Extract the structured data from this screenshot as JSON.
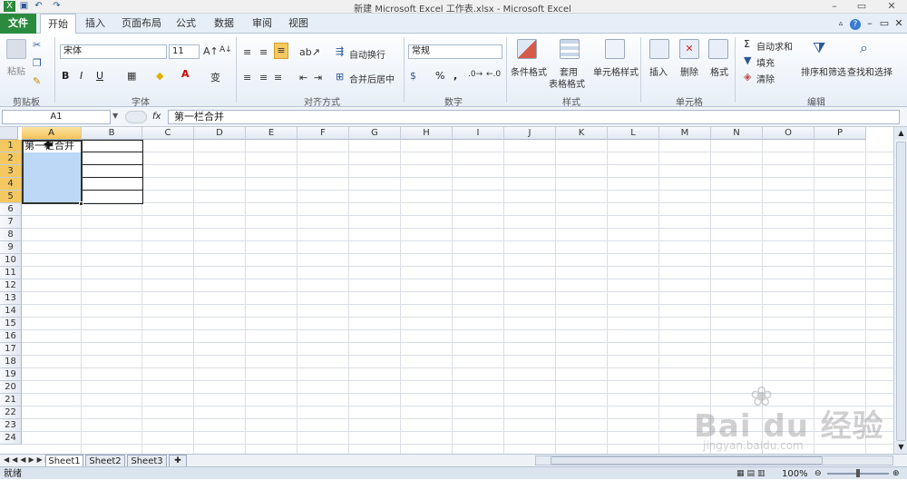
{
  "window": {
    "title": "新建 Microsoft Excel 工作表.xlsx - Microsoft Excel"
  },
  "tabs": [
    "文件",
    "开始",
    "插入",
    "页面布局",
    "公式",
    "数据",
    "审阅",
    "视图"
  ],
  "ribbon": {
    "clipboard": {
      "paste": "粘贴",
      "group": "剪贴板"
    },
    "font": {
      "name": "宋体",
      "size": "11",
      "bold": "B",
      "italic": "I",
      "underline": "U",
      "group": "字体"
    },
    "alignment": {
      "wrap": "自动换行",
      "merge": "合并后居中",
      "group": "对齐方式"
    },
    "number": {
      "format": "常规",
      "percent": "%",
      "comma": ",",
      "group": "数字"
    },
    "styles": {
      "conditional": "条件格式",
      "table_line1": "套用",
      "table_line2": "表格格式",
      "cell_styles": "单元格样式",
      "group": "样式"
    },
    "cells": {
      "insert": "插入",
      "delete": "删除",
      "format": "格式",
      "group": "单元格"
    },
    "editing": {
      "autosum": "自动求和",
      "fill": "填充",
      "clear": "清除",
      "sort": "排序和筛选",
      "find": "查找和选择",
      "group": "编辑"
    }
  },
  "formula_bar": {
    "name_box": "A1",
    "fx": "fx",
    "value": "第一栏合并"
  },
  "columns": [
    "A",
    "B",
    "C",
    "D",
    "E",
    "F",
    "G",
    "H",
    "I",
    "J",
    "K",
    "L",
    "M",
    "N",
    "O",
    "P"
  ],
  "rows": [
    "1",
    "2",
    "3",
    "4",
    "5",
    "6",
    "7",
    "8",
    "9",
    "10",
    "11",
    "12",
    "13",
    "14",
    "15",
    "16",
    "17",
    "18",
    "19",
    "20",
    "21",
    "22",
    "23",
    "24"
  ],
  "cells": {
    "A1": "第一栏合并"
  },
  "sheets": [
    "Sheet1",
    "Sheet2",
    "Sheet3"
  ],
  "status": {
    "ready": "就绪",
    "zoom": "100%"
  },
  "watermark": {
    "brand": "Bai du 经验",
    "url": "jingyan.baidu.com"
  }
}
